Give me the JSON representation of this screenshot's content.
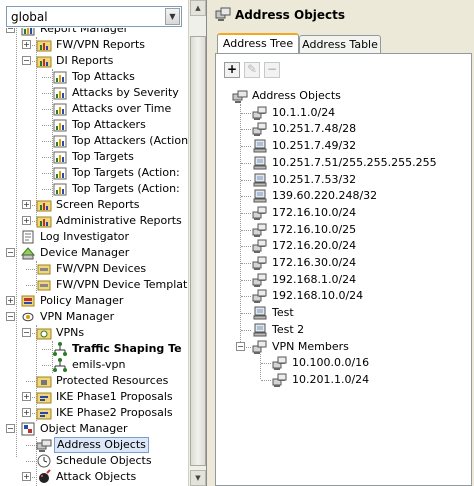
{
  "domain_selector": {
    "value": "global"
  },
  "left_tree": {
    "items": [
      {
        "label": "Report Manager",
        "icon": "report-manager-icon",
        "level": 0,
        "expander": "minus"
      },
      {
        "label": "FW/VPN Reports",
        "icon": "report-folder-icon",
        "level": 1,
        "expander": "plus"
      },
      {
        "label": "DI Reports",
        "icon": "report-folder-icon",
        "level": 1,
        "expander": "minus"
      },
      {
        "label": "Top Attacks",
        "icon": "report-icon",
        "level": 2
      },
      {
        "label": "Attacks by Severity",
        "icon": "report-icon",
        "level": 2
      },
      {
        "label": "Attacks over Time",
        "icon": "report-icon",
        "level": 2
      },
      {
        "label": "Top Attackers",
        "icon": "report-icon",
        "level": 2
      },
      {
        "label": "Top Attackers (Action",
        "icon": "report-icon",
        "level": 2
      },
      {
        "label": "Top Targets",
        "icon": "report-icon",
        "level": 2
      },
      {
        "label": "Top Targets (Action:",
        "icon": "report-icon",
        "level": 2
      },
      {
        "label": "Top Targets (Action:",
        "icon": "report-icon",
        "level": 2
      },
      {
        "label": "Screen Reports",
        "icon": "report-folder-icon",
        "level": 1,
        "expander": "plus"
      },
      {
        "label": "Administrative Reports",
        "icon": "report-folder-icon",
        "level": 1,
        "expander": "plus"
      },
      {
        "label": "Log Investigator",
        "icon": "log-investigator-icon",
        "level": 0
      },
      {
        "label": "Device Manager",
        "icon": "device-manager-icon",
        "level": 0,
        "expander": "minus"
      },
      {
        "label": "FW/VPN Devices",
        "icon": "devices-icon",
        "level": 1
      },
      {
        "label": "FW/VPN Device Template",
        "icon": "devices-icon",
        "level": 1
      },
      {
        "label": "Policy Manager",
        "icon": "policy-manager-icon",
        "level": 0,
        "expander": "plus"
      },
      {
        "label": "VPN Manager",
        "icon": "vpn-manager-icon",
        "level": 0,
        "expander": "minus"
      },
      {
        "label": "VPNs",
        "icon": "vpn-folder-icon",
        "level": 1,
        "expander": "minus"
      },
      {
        "label": "Traffic Shaping Te",
        "icon": "vpn-topology-icon",
        "level": 2,
        "bold": true
      },
      {
        "label": "emils-vpn",
        "icon": "vpn-topology-icon",
        "level": 2
      },
      {
        "label": "Protected Resources",
        "icon": "protected-resources-icon",
        "level": 1
      },
      {
        "label": "IKE Phase1 Proposals",
        "icon": "proposal-folder-icon",
        "level": 1,
        "expander": "plus"
      },
      {
        "label": "IKE Phase2 Proposals",
        "icon": "proposal-folder-icon",
        "level": 1,
        "expander": "plus"
      },
      {
        "label": "Object Manager",
        "icon": "object-manager-icon",
        "level": 0,
        "expander": "minus"
      },
      {
        "label": "Address Objects",
        "icon": "address-objects-icon",
        "level": 1,
        "selected": true
      },
      {
        "label": "Schedule Objects",
        "icon": "schedule-icon",
        "level": 1
      },
      {
        "label": "Attack Objects",
        "icon": "attack-objects-icon",
        "level": 1,
        "expander": "plus"
      }
    ]
  },
  "right_panel": {
    "title": "Address Objects",
    "tabs": [
      {
        "label": "Address Tree",
        "active": true
      },
      {
        "label": "Address Table",
        "active": false
      }
    ],
    "toolbar": {
      "add": "+",
      "edit": "✎",
      "delete": "−"
    },
    "tree": {
      "items": [
        {
          "label": "Address Objects",
          "icon": "address-root-icon",
          "level": 0,
          "type": "root"
        },
        {
          "label": "10.1.1.0/24",
          "icon": "network-icon",
          "level": 1,
          "type": "network"
        },
        {
          "label": "10.251.7.48/28",
          "icon": "network-icon",
          "level": 1,
          "type": "network"
        },
        {
          "label": "10.251.7.49/32",
          "icon": "host-icon",
          "level": 1,
          "type": "host"
        },
        {
          "label": "10.251.7.51/255.255.255.255",
          "icon": "host-icon",
          "level": 1,
          "type": "host"
        },
        {
          "label": "10.251.7.53/32",
          "icon": "host-icon",
          "level": 1,
          "type": "host"
        },
        {
          "label": "139.60.220.248/32",
          "icon": "host-icon",
          "level": 1,
          "type": "host"
        },
        {
          "label": "172.16.10.0/24",
          "icon": "network-icon",
          "level": 1,
          "type": "network"
        },
        {
          "label": "172.16.10.0/25",
          "icon": "network-icon",
          "level": 1,
          "type": "network"
        },
        {
          "label": "172.16.20.0/24",
          "icon": "network-icon",
          "level": 1,
          "type": "network"
        },
        {
          "label": "172.16.30.0/24",
          "icon": "network-icon",
          "level": 1,
          "type": "network"
        },
        {
          "label": "192.168.1.0/24",
          "icon": "network-icon",
          "level": 1,
          "type": "network"
        },
        {
          "label": "192.168.10.0/24",
          "icon": "network-icon",
          "level": 1,
          "type": "network"
        },
        {
          "label": "Test",
          "icon": "host-icon",
          "level": 1,
          "type": "host"
        },
        {
          "label": "Test 2",
          "icon": "host-icon",
          "level": 1,
          "type": "host"
        },
        {
          "label": "VPN Members",
          "icon": "group-icon",
          "level": 1,
          "type": "group",
          "expander": "minus"
        },
        {
          "label": "10.100.0.0/16",
          "icon": "network-icon",
          "level": 2,
          "type": "network"
        },
        {
          "label": "10.201.1.0/24",
          "icon": "network-icon",
          "level": 2,
          "type": "network"
        }
      ]
    }
  },
  "colors": {
    "background": "#ece9d8",
    "selection": "#dce8f7",
    "selection_border": "#7a9cd1",
    "tab_accent": "#f5a623"
  }
}
